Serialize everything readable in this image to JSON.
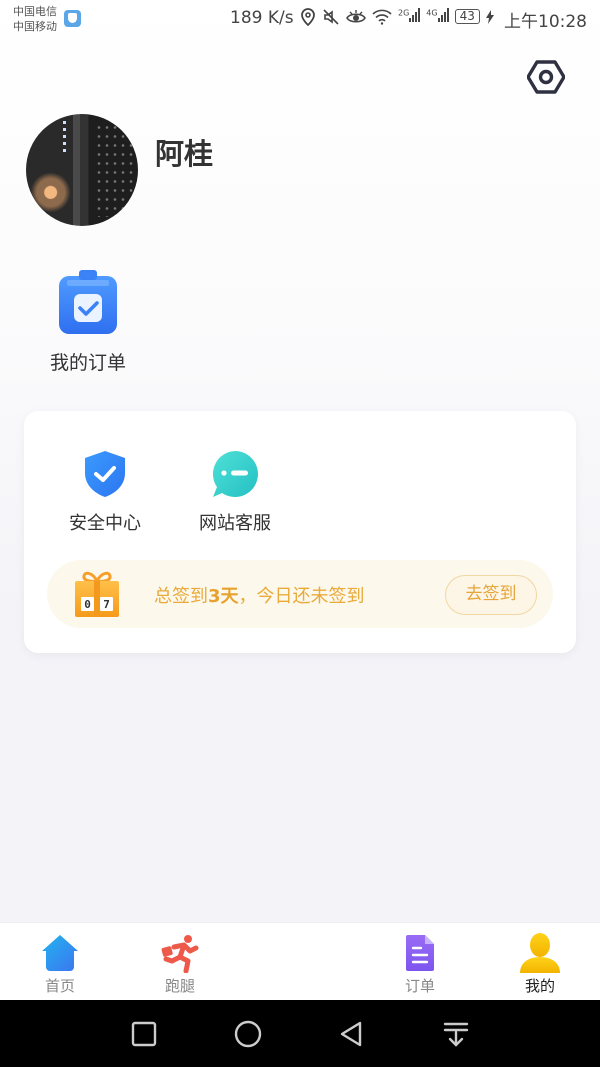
{
  "status_bar": {
    "carrier_1": "中国电信",
    "carrier_2": "中国移动",
    "network_speed": "189 K/s",
    "signal_1_label": "2G",
    "signal_2_label": "4G",
    "battery": "43",
    "time": "上午10:28",
    "icons": [
      "shield-icon",
      "location-icon",
      "mute-icon",
      "eye-icon",
      "wifi-icon",
      "signal-icon",
      "signal-icon",
      "battery-icon",
      "charging-icon"
    ]
  },
  "header": {
    "settings_icon": "settings-hexagon-icon"
  },
  "profile": {
    "username": "阿桂"
  },
  "shortcuts": {
    "my_orders_label": "我的订单"
  },
  "services": [
    {
      "label": "安全中心",
      "icon": "shield-check-icon",
      "color": "#3d8ef8"
    },
    {
      "label": "网站客服",
      "icon": "chat-bubble-icon",
      "color": "#3ad0cc"
    }
  ],
  "signin": {
    "text_prefix": "总签到",
    "days": "3天",
    "text_suffix": "，今日还未签到",
    "button_label": "去签到",
    "gift_counter": "07",
    "accent_color": "#e9aa3a"
  },
  "tabbar": {
    "items": [
      {
        "label": "首页",
        "icon": "home-icon",
        "active": false
      },
      {
        "label": "跑腿",
        "icon": "runner-icon",
        "active": false
      },
      {
        "label": "订单",
        "icon": "document-icon",
        "active": false
      },
      {
        "label": "我的",
        "icon": "user-icon",
        "active": true
      }
    ]
  },
  "system_nav": {
    "buttons": [
      "recents",
      "home",
      "back",
      "notifications-pull-down"
    ]
  }
}
